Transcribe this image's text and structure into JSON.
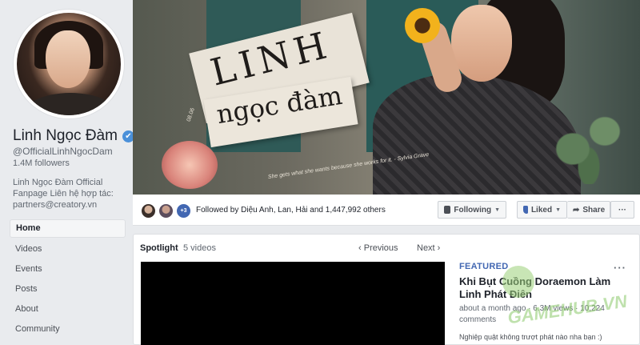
{
  "page": {
    "name": "Linh Ngọc Đàm",
    "handle": "@OfficialLinhNgocDam",
    "followers": "1.4M followers",
    "about": "Linh Ngọc Đàm Official Fanpage Liên hệ hợp tác: partners@creatory.vn",
    "verified_glyph": "✔"
  },
  "nav": {
    "items": [
      "Home",
      "Videos",
      "Events",
      "Posts",
      "About",
      "Community"
    ]
  },
  "cover": {
    "title_line1": "LINH",
    "title_line2": "ngọc đàm",
    "date": "08.06",
    "quote": "She gets what she wants because she works for it. - Sylvia Grave"
  },
  "actionbar": {
    "more_friends": "+3",
    "followed_by": "Followed by Diệu Anh, Lan, Hải and 1,447,992 others",
    "following_label": "Following",
    "liked_label": "Liked",
    "share_label": "Share",
    "more_label": "···"
  },
  "spotlight": {
    "title": "Spotlight",
    "count": "5 videos",
    "prev_label": "Previous",
    "next_label": "Next",
    "featured_label": "FEATURED",
    "more_label": "···",
    "video_title": "Khi Bụt Cuồng Doraemon Làm Linh Phát Điên",
    "video_meta": "about a month ago · 6.3M views · 10,224 comments",
    "video_desc": "Nghiệp quật không trượt phát nào nha bạn :)"
  },
  "watermark": {
    "text": "GAMEHUB.VN"
  },
  "colors": {
    "background": "#e9ebee",
    "accent": "#4267b2",
    "verified": "#4a90d9"
  }
}
